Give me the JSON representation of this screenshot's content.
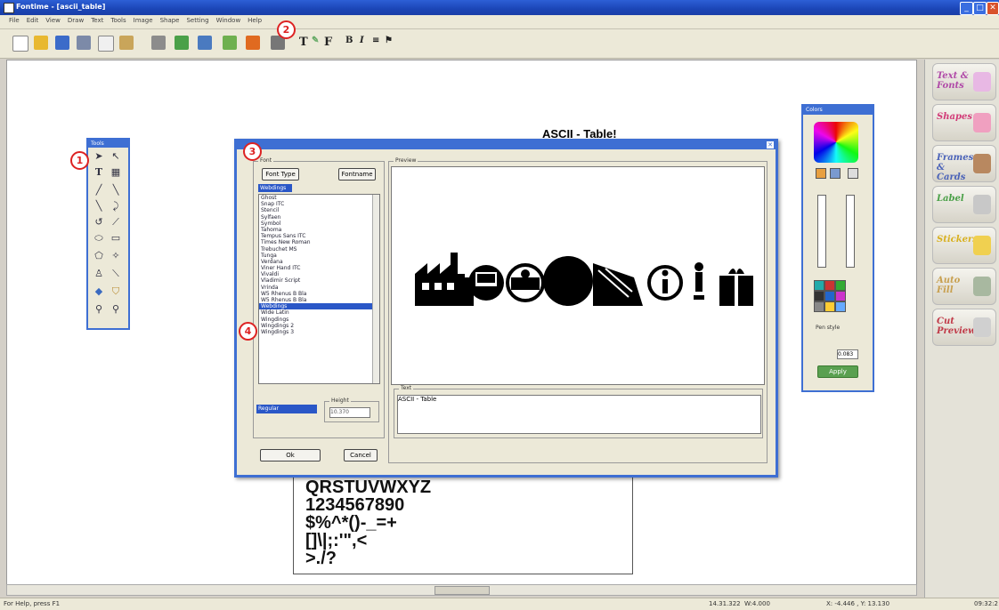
{
  "window": {
    "title": "Fontime - [ascii_table]",
    "min": "_",
    "max": "□",
    "close": "✕"
  },
  "menu": [
    "File",
    "Edit",
    "View",
    "Draw",
    "Text",
    "Tools",
    "Image",
    "Shape",
    "Setting",
    "Window",
    "Help"
  ],
  "page": {
    "title": "ASCII - Table!",
    "lines": [
      "QRSTUVWXYZ",
      "1234567890",
      "$%^*()-_=+",
      "[]\\|;:'\",<",
      ">./?"
    ]
  },
  "tools_panel": {
    "title": "Tools"
  },
  "color_panel": {
    "title": "Colors",
    "pen_style_label": "Pen style",
    "pen_width": "0.083",
    "apply_label": "Apply"
  },
  "right_panel": {
    "buttons": [
      {
        "label": "Text & Fonts",
        "color": "#b04aa8"
      },
      {
        "label": "Shapes",
        "color": "#d23b78"
      },
      {
        "label": "Frames & Cards",
        "color": "#4a62b8"
      },
      {
        "label": "Label",
        "color": "#4aa048"
      },
      {
        "label": "Stickers",
        "color": "#d8b020"
      },
      {
        "label": "Auto Fill",
        "color": "#c8a050"
      },
      {
        "label": "Cut Preview",
        "color": "#c03a48"
      }
    ]
  },
  "dialog": {
    "font_group_label": "Font",
    "font_type_button": "Font Type",
    "fontname_button": "Fontname",
    "font_input": "Webdings",
    "fonts": [
      "Ghost",
      "Snap ITC",
      "Stencil",
      "Sylfaen",
      "Symbol",
      "Tahoma",
      "Tempus Sans ITC",
      "Times New Roman",
      "Trebuchet MS",
      "Tunga",
      "Verdana",
      "Viner Hand ITC",
      "Vivaldi",
      "Vladimir Script",
      "Vrinda",
      "W5 Rhenus B Bla",
      "W5 Rhenus B Bla",
      "Webdings",
      "Wide Latin",
      "Wingdings",
      "Wingdings 2",
      "Wingdings 3"
    ],
    "selected_font_index": 17,
    "style_value": "Regular",
    "height_label": "Height",
    "height_value": "10.370",
    "ok_label": "Ok",
    "cancel_label": "Cancel",
    "preview_label": "Preview",
    "text_label": "Text",
    "text_value": "ASCII - Table"
  },
  "callouts": [
    "1",
    "2",
    "3",
    "4"
  ],
  "status": {
    "left": "For Help, press F1",
    "coords1": "14.31.322",
    "coords2": "W:4.000 ",
    "coords3": "X: -4.446 , Y: 13.130",
    "time": "09:32:2"
  },
  "colors": {
    "accent": "#3e6fd3",
    "selection": "#2a57c7",
    "callout": "#dd2222"
  }
}
